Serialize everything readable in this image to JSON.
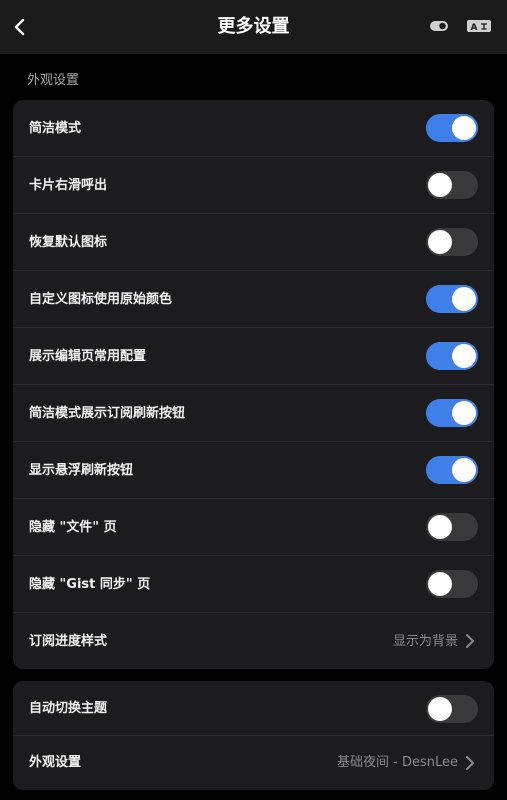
{
  "header": {
    "title": "更多设置",
    "back_icon": "chevron-left-icon",
    "toggle_icon": "theme-toggle-icon",
    "translate_icon": "translate-icon",
    "translate_text": "A"
  },
  "section": {
    "label": "外观设置"
  },
  "card1": {
    "rows": [
      {
        "label": "简洁模式",
        "on": true
      },
      {
        "label": "卡片右滑呼出",
        "on": false
      },
      {
        "label": "恢复默认图标",
        "on": false
      },
      {
        "label": "自定义图标使用原始颜色",
        "on": true
      },
      {
        "label": "展示编辑页常用配置",
        "on": true
      },
      {
        "label": "简洁模式展示订阅刷新按钮",
        "on": true
      },
      {
        "label": "显示悬浮刷新按钮",
        "on": true
      },
      {
        "label": "隐藏 \"文件\" 页",
        "on": false
      },
      {
        "label": "隐藏 \"Gist 同步\" 页",
        "on": false
      }
    ],
    "progress_style": {
      "label": "订阅进度样式",
      "value": "显示为背景"
    }
  },
  "card2": {
    "auto_theme": {
      "label": "自动切换主题",
      "on": false
    },
    "appearance": {
      "label": "外观设置",
      "value": "基础夜间 - DesnLee"
    }
  },
  "colors": {
    "accent": "#3f80e8",
    "toggle_off": "#3a3a3c",
    "card_bg": "#1c1c1e",
    "page_bg": "#000000"
  }
}
